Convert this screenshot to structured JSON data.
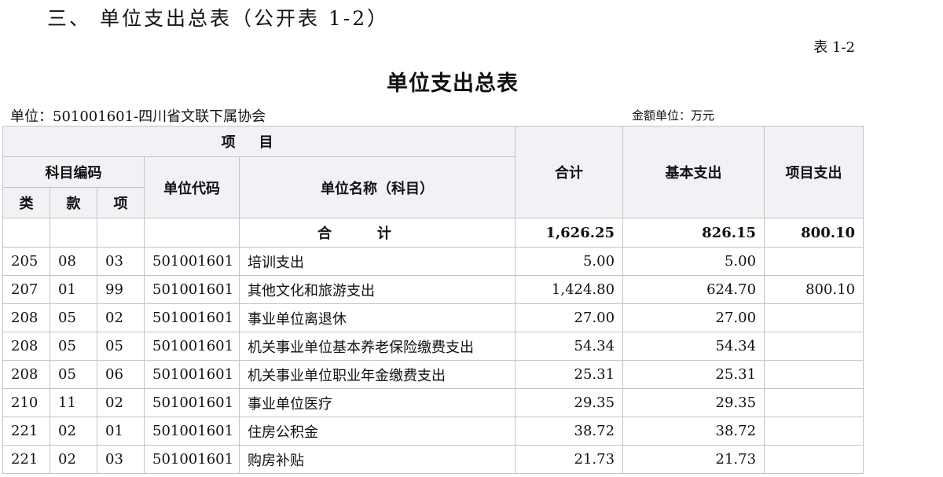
{
  "document": {
    "section_heading": "三、 单位支出总表（公开表 1-2）",
    "table_number": "表 1-2",
    "title": "单位支出总表",
    "unit_label": "单位：501001601-四川省文联下属协会",
    "amount_unit": "金额单位：万元"
  },
  "table": {
    "headers": {
      "project": "项目",
      "subject_code": "科目编码",
      "category": "类",
      "section": "款",
      "item": "项",
      "unit_code": "单位代码",
      "unit_name": "单位名称（科目）",
      "total": "合计",
      "basic_expenditure": "基本支出",
      "project_expenditure": "项目支出"
    },
    "total_row": {
      "label": "合计",
      "total": "1,626.25",
      "basic": "826.15",
      "project": "800.10"
    },
    "rows": [
      {
        "category": "205",
        "section": "08",
        "item": "03",
        "unit_code": "501001601",
        "name": "培训支出",
        "total": "5.00",
        "basic": "5.00",
        "project": ""
      },
      {
        "category": "207",
        "section": "01",
        "item": "99",
        "unit_code": "501001601",
        "name": "其他文化和旅游支出",
        "total": "1,424.80",
        "basic": "624.70",
        "project": "800.10"
      },
      {
        "category": "208",
        "section": "05",
        "item": "02",
        "unit_code": "501001601",
        "name": "事业单位离退休",
        "total": "27.00",
        "basic": "27.00",
        "project": ""
      },
      {
        "category": "208",
        "section": "05",
        "item": "05",
        "unit_code": "501001601",
        "name": "机关事业单位基本养老保险缴费支出",
        "total": "54.34",
        "basic": "54.34",
        "project": ""
      },
      {
        "category": "208",
        "section": "05",
        "item": "06",
        "unit_code": "501001601",
        "name": "机关事业单位职业年金缴费支出",
        "total": "25.31",
        "basic": "25.31",
        "project": ""
      },
      {
        "category": "210",
        "section": "11",
        "item": "02",
        "unit_code": "501001601",
        "name": "事业单位医疗",
        "total": "29.35",
        "basic": "29.35",
        "project": ""
      },
      {
        "category": "221",
        "section": "02",
        "item": "01",
        "unit_code": "501001601",
        "name": "住房公积金",
        "total": "38.72",
        "basic": "38.72",
        "project": ""
      },
      {
        "category": "221",
        "section": "02",
        "item": "03",
        "unit_code": "501001601",
        "name": "购房补贴",
        "total": "21.73",
        "basic": "21.73",
        "project": ""
      }
    ]
  }
}
